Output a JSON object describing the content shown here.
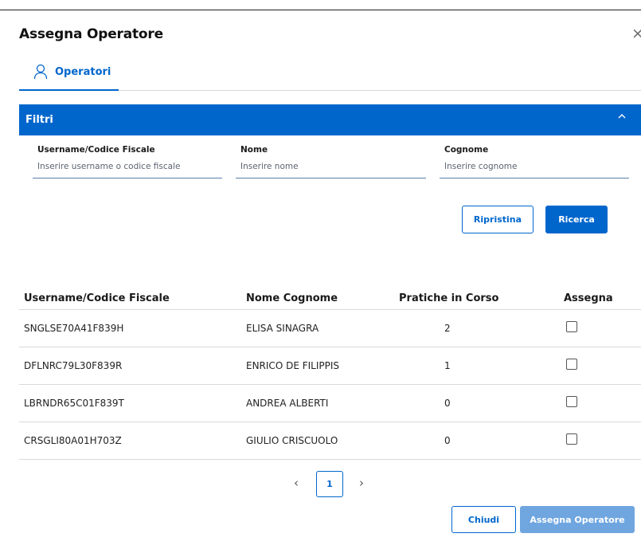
{
  "modal": {
    "title": "Assegna Operatore",
    "close_glyph": "×"
  },
  "tab": {
    "label": "Operatori",
    "icon": "user-icon"
  },
  "filters": {
    "title": "Filtri",
    "chevron": "^",
    "fields": [
      {
        "label": "Username/Codice Fiscale",
        "placeholder": "Inserire username o codice fiscale"
      },
      {
        "label": "Nome",
        "placeholder": "Inserire nome"
      },
      {
        "label": "Cognome",
        "placeholder": "Inserire cognome"
      }
    ],
    "reset_label": "Ripristina",
    "search_label": "Ricerca"
  },
  "table": {
    "headers": [
      "Username/Codice Fiscale",
      "Nome Cognome",
      "Pratiche in Corso",
      "Assegna"
    ],
    "rows": [
      {
        "username": "SNGLSE70A41F839H",
        "name": "ELISA SINAGRA",
        "count": "2",
        "checked": false
      },
      {
        "username": "DFLNRC79L30F839R",
        "name": "ENRICO DE FILIPPIS",
        "count": "1",
        "checked": false
      },
      {
        "username": "LBRNDR65C01F839T",
        "name": "ANDREA ALBERTI",
        "count": "0",
        "checked": false
      },
      {
        "username": "CRSGLI80A01H703Z",
        "name": "GIULIO CRISCUOLO",
        "count": "0",
        "checked": false
      }
    ]
  },
  "pagination": {
    "prev": "‹",
    "current": "1",
    "next": "›"
  },
  "footer": {
    "close_label": "Chiudi",
    "assign_label": "Assegna Operatore"
  }
}
